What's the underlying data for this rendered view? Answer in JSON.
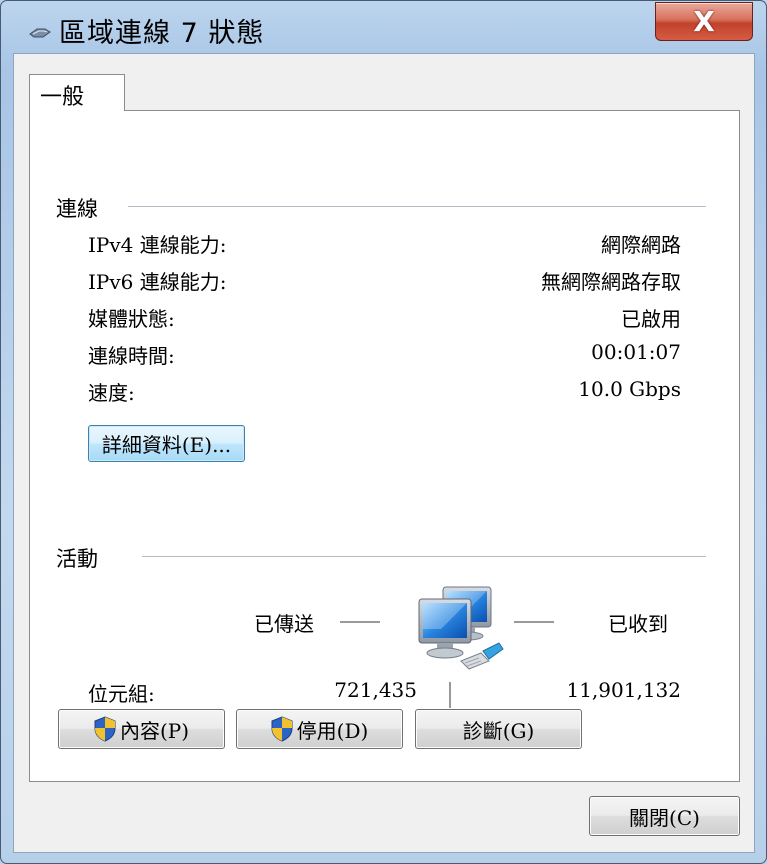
{
  "window": {
    "title": "區域連線 7 狀態",
    "close_label": "X"
  },
  "tabs": [
    {
      "label": "一般"
    }
  ],
  "connection": {
    "section_title": "連線",
    "rows": [
      {
        "label": "IPv4 連線能力:",
        "value": "網際網路"
      },
      {
        "label": "IPv6 連線能力:",
        "value": "無網際網路存取"
      },
      {
        "label": "媒體狀態:",
        "value": "已啟用"
      },
      {
        "label": "連線時間:",
        "value": "00:01:07"
      },
      {
        "label": "速度:",
        "value": "10.0 Gbps"
      }
    ],
    "details_button": "詳細資料(E)..."
  },
  "activity": {
    "section_title": "活動",
    "sent_label": "已傳送",
    "received_label": "已收到",
    "bytes_label": "位元組:",
    "bytes_sent": "721,435",
    "bytes_received": "11,901,132"
  },
  "buttons": {
    "properties": "內容(P)",
    "disable": "停用(D)",
    "diagnose": "診斷(G)",
    "close": "關閉(C)"
  },
  "icons": {
    "app": "network-connection-icon",
    "activity": "network-computers-icon",
    "uac": "uac-shield-icon"
  },
  "colors": {
    "title_bar": "#bcd5ee",
    "close_button": "#c2412a",
    "focused_button": "#bee6fd"
  }
}
